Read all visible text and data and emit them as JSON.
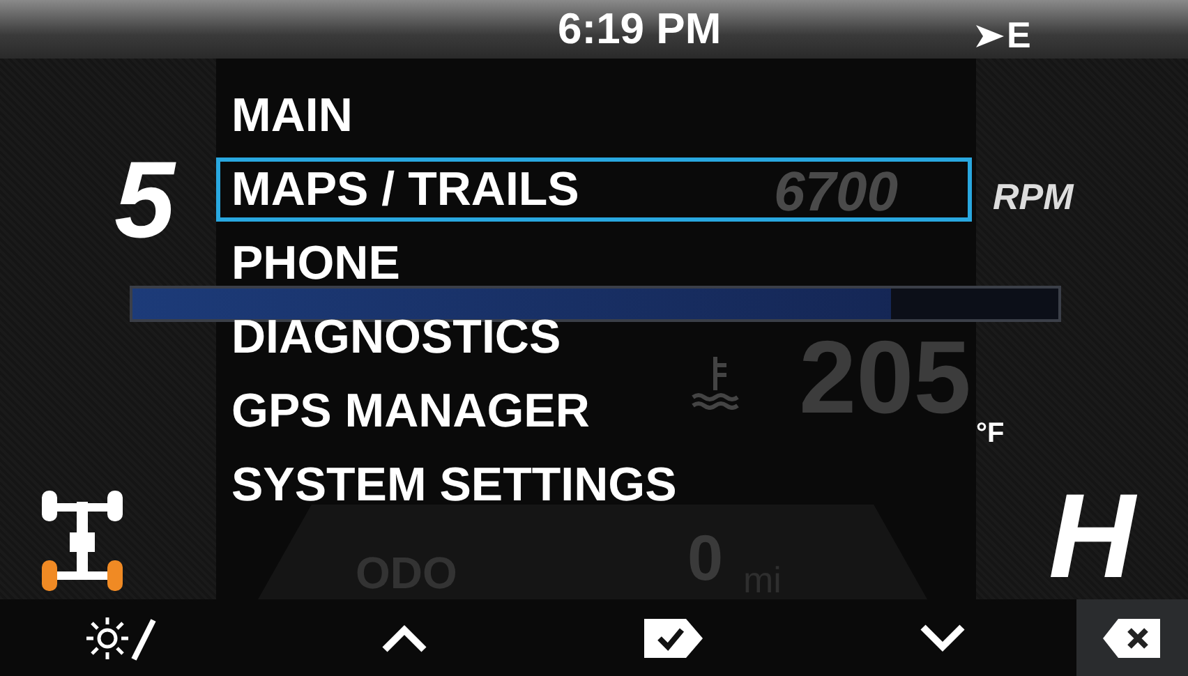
{
  "status_bar": {
    "time": "6:19 PM",
    "heading": "E"
  },
  "dashboard": {
    "gear": "5",
    "rpm": "6700",
    "rpm_unit": "RPM",
    "tach": {
      "level": 0.82
    },
    "coolant_temp": "205",
    "temp_unit": "°F",
    "odo_label": "ODO",
    "odo_value": "0",
    "odo_unit": "mi",
    "drive_mode": "H",
    "front_axle_engaged": false,
    "rear_axle_engaged": true
  },
  "menu": {
    "items": [
      {
        "label": "MAIN",
        "selected": false
      },
      {
        "label": "MAPS / TRAILS",
        "selected": true
      },
      {
        "label": "PHONE",
        "selected": false
      },
      {
        "label": "DIAGNOSTICS",
        "selected": false
      },
      {
        "label": "GPS MANAGER",
        "selected": false
      },
      {
        "label": "SYSTEM SETTINGS",
        "selected": false
      }
    ]
  },
  "softkeys": [
    {
      "kind": "day-night"
    },
    {
      "kind": "up"
    },
    {
      "kind": "select"
    },
    {
      "kind": "down"
    },
    {
      "kind": "back"
    }
  ]
}
